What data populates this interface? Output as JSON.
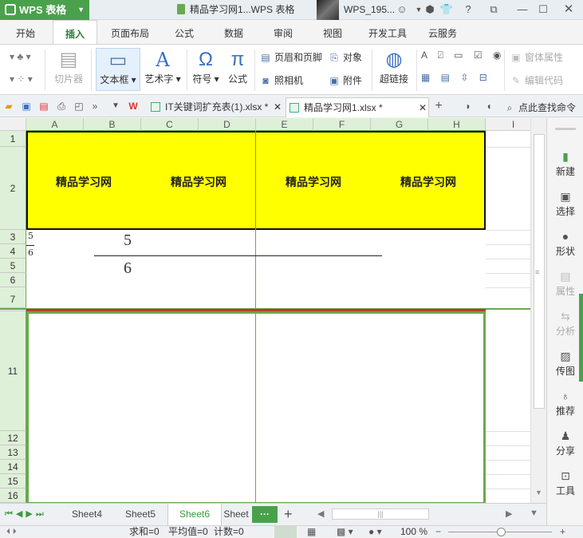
{
  "titlebar": {
    "app_name": "WPS 表格",
    "doc_title": "精品学习网1...WPS 表格",
    "user": "WPS_195...",
    "icons": [
      "skin-icon",
      "shirt-icon",
      "help-icon",
      "restore-icon",
      "minimize-icon",
      "maximize-icon",
      "close-icon"
    ]
  },
  "ribbon_tabs": [
    "开始",
    "插入",
    "页面布局",
    "公式",
    "数据",
    "审阅",
    "视图",
    "开发工具",
    "云服务"
  ],
  "ribbon": {
    "slicer": "切片器",
    "textbox": "文本框",
    "wordart": "艺术字",
    "symbol": "符号",
    "formula": "公式",
    "header_footer": "页眉和页脚",
    "object": "对象",
    "camera": "照相机",
    "attachment": "附件",
    "hyperlink": "超链接",
    "form_props": "窗体属性",
    "edit_code": "编辑代码"
  },
  "doc_tabs": {
    "tab1": "IT关键词扩充表(1).xlsx *",
    "tab2": "精品学习网1.xlsx *",
    "search": "点此查找命令"
  },
  "columns": [
    "A",
    "B",
    "C",
    "D",
    "E",
    "F",
    "G",
    "H",
    "I"
  ],
  "rows": [
    "1",
    "2",
    "3",
    "4",
    "5",
    "6",
    "7",
    "11",
    "12",
    "13",
    "14",
    "15",
    "16"
  ],
  "cells": {
    "header_texts": [
      "精品学习网",
      "精品学习网",
      "精品学习网",
      "精品学习网"
    ],
    "a3": "5",
    "a4": "6",
    "fraction_numerator": "5",
    "fraction_denominator": "6"
  },
  "right_panel": [
    "新建",
    "选择",
    "形状",
    "属性",
    "分析",
    "传图",
    "推荐",
    "分享",
    "工具"
  ],
  "sheet_tabs": [
    "Sheet4",
    "Sheet5",
    "Sheet6",
    "Sheet"
  ],
  "active_sheet": "Sheet6",
  "status": {
    "sum": "求和=0",
    "avg": "平均值=0",
    "count": "计数=0",
    "zoom": "100 %"
  },
  "colors": {
    "accent": "#4aa14c",
    "header_fill": "#ffff00",
    "selection_border": "#6aa84f",
    "freeze_line": "#c0392b"
  }
}
